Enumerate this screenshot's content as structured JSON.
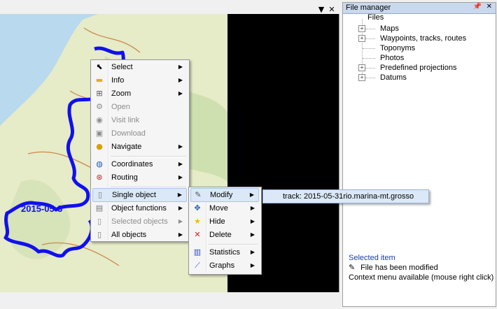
{
  "map_window": {
    "pin_glyph": "▼",
    "close_glyph": "✕",
    "map_label": "2015-05-3"
  },
  "file_manager": {
    "title": "File manager",
    "pin_glyph": "📌",
    "close_glyph": "✕",
    "tree": {
      "root": "Files",
      "items": [
        {
          "label": "Maps",
          "expandable": true
        },
        {
          "label": "Waypoints, tracks, routes",
          "expandable": true
        },
        {
          "label": "Toponyms",
          "expandable": false
        },
        {
          "label": "Photos",
          "expandable": false
        },
        {
          "label": "Predefined projections",
          "expandable": true
        },
        {
          "label": "Datums",
          "expandable": true
        }
      ]
    },
    "selected_item": {
      "heading": "Selected item",
      "modified": "File has been modified",
      "context": "Context menu available (mouse right click)"
    }
  },
  "context_menu": {
    "items": [
      {
        "label": "Select",
        "icon": "cursor-icon",
        "submenu": true,
        "disabled": false
      },
      {
        "label": "Info",
        "icon": "folder-icon",
        "submenu": true,
        "disabled": false
      },
      {
        "label": "Zoom",
        "icon": "zoom-icon",
        "submenu": true,
        "disabled": false
      },
      {
        "label": "Open",
        "icon": "open-icon",
        "submenu": false,
        "disabled": true
      },
      {
        "label": "Visit link",
        "icon": "link-icon",
        "submenu": false,
        "disabled": true
      },
      {
        "label": "Download",
        "icon": "download-icon",
        "submenu": false,
        "disabled": true
      },
      {
        "label": "Navigate",
        "icon": "navigate-icon",
        "submenu": true,
        "disabled": false
      },
      {
        "label": "Coordinates",
        "icon": "globe-icon",
        "submenu": true,
        "disabled": false
      },
      {
        "label": "Routing",
        "icon": "routing-icon",
        "submenu": true,
        "disabled": false
      },
      {
        "label": "Single object",
        "icon": "document-icon",
        "submenu": true,
        "disabled": false
      },
      {
        "label": "Object functions",
        "icon": "functions-icon",
        "submenu": true,
        "disabled": false
      },
      {
        "label": "Selected objects",
        "icon": "selected-icon",
        "submenu": true,
        "disabled": true
      },
      {
        "label": "All objects",
        "icon": "all-objects-icon",
        "submenu": true,
        "disabled": false
      }
    ]
  },
  "single_object_menu": {
    "items": [
      {
        "label": "Modify",
        "icon": "pencil-icon"
      },
      {
        "label": "Move",
        "icon": "move-icon"
      },
      {
        "label": "Hide",
        "icon": "star-icon"
      },
      {
        "label": "Delete",
        "icon": "delete-icon"
      },
      {
        "label": "Statistics",
        "icon": "bar-chart-icon"
      },
      {
        "label": "Graphs",
        "icon": "line-graph-icon"
      }
    ]
  },
  "modify_menu": {
    "item": "track: 2015-05-31rio.marina-mt.grosso"
  },
  "colors": {
    "track": "#1010ee",
    "sea": "#b8d9ee",
    "land": "#e6ebc8",
    "highlight": "#dbe8f7"
  }
}
